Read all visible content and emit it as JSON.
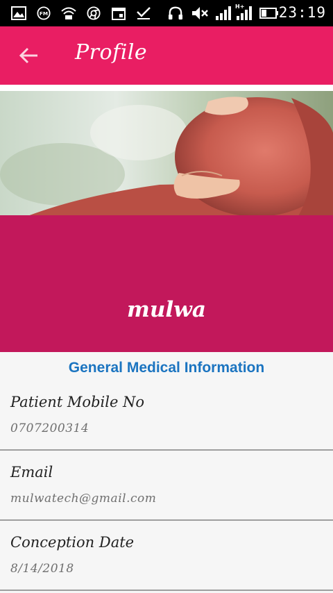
{
  "status_bar": {
    "time": "23:19",
    "icons": [
      "image-icon",
      "fm-radio-icon",
      "wifi-icon",
      "chrome-icon",
      "calendar-icon",
      "download-done-icon",
      "headphones-icon",
      "mute-icon",
      "signal-icon",
      "signal-hplus-icon",
      "battery-icon"
    ]
  },
  "toolbar": {
    "back_icon": "arrow-left-icon",
    "title": "Profile"
  },
  "profile": {
    "name": "mulwa"
  },
  "section": {
    "title": "General Medical Information"
  },
  "fields": [
    {
      "label": "Patient Mobile No",
      "value": "0707200314"
    },
    {
      "label": "Email",
      "value": "mulwatech@gmail.com"
    },
    {
      "label": "Conception Date",
      "value": "8/14/2018"
    }
  ],
  "colors": {
    "toolbar": "#e91e63",
    "banner": "#c2185b",
    "section_title": "#1b74c0"
  }
}
